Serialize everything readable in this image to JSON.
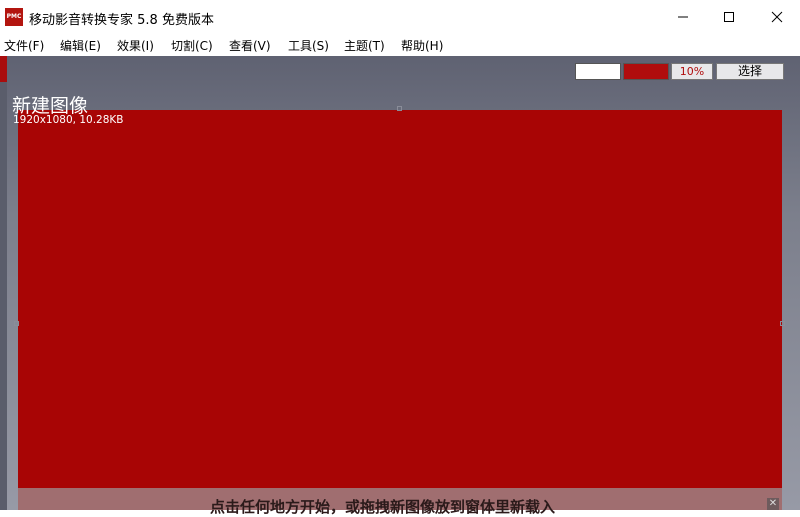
{
  "window": {
    "title": "移动影音转换专家 5.8 免费版本",
    "icon_text": "PMC",
    "icon_color": "#b3150f"
  },
  "menu": [
    {
      "label": "文件(F)"
    },
    {
      "label": "编辑(E)"
    },
    {
      "label": "效果(I)"
    },
    {
      "label": "切割(C)"
    },
    {
      "label": "查看(V)"
    },
    {
      "label": "工具(S)"
    },
    {
      "label": "主题(T)"
    },
    {
      "label": "帮助(H)"
    }
  ],
  "toolbar": {
    "color1": "#ffffff",
    "color2": "#b00d0d",
    "zoom": "10%",
    "select_label": "选择"
  },
  "canvas": {
    "title": "新建图像",
    "info": "1920x1080, 10.28KB",
    "fill_color": "#a80505"
  },
  "hint": {
    "text": "点击任何地方开始，或拖拽新图像放到窗体里新载入",
    "close_icon": "close-icon"
  }
}
